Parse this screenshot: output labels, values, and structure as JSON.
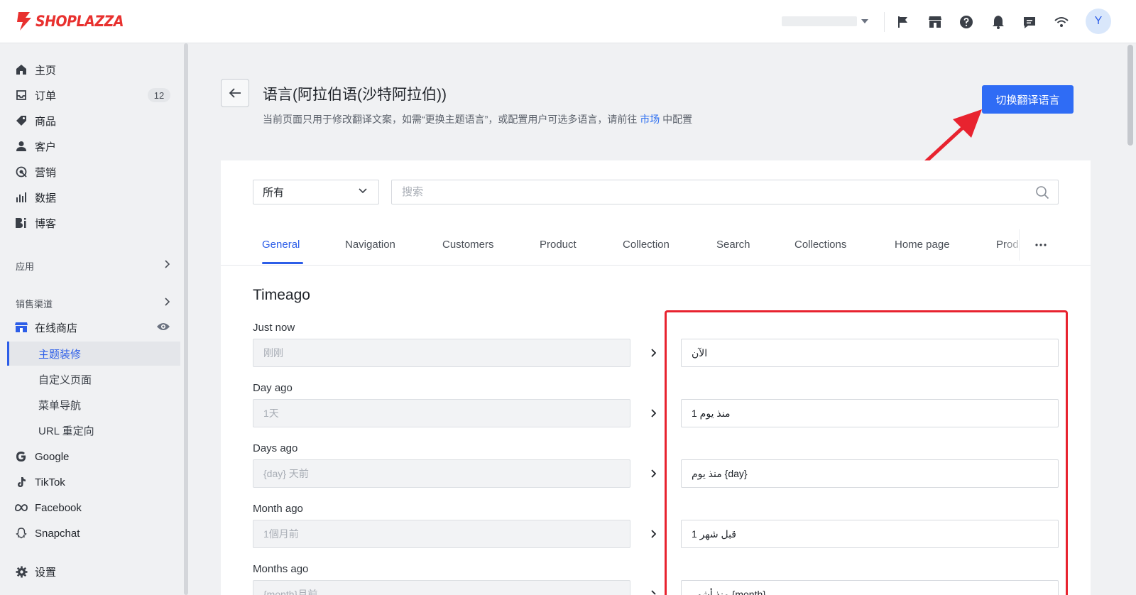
{
  "app": {
    "brand": "SHOPLAZZA",
    "avatar_initial": "Y",
    "accent": "#2f6cf5",
    "brand_color": "#e8312f",
    "highlight_color": "#e8232f"
  },
  "topbar": {
    "icons": [
      "flag-icon",
      "store-icon",
      "help-icon",
      "bell-icon",
      "chat-icon",
      "wifi-icon"
    ]
  },
  "sidebar": {
    "items": [
      {
        "label": "主页",
        "icon": "home-icon"
      },
      {
        "label": "订单",
        "icon": "inbox-icon",
        "badge": "12"
      },
      {
        "label": "商品",
        "icon": "tag-icon"
      },
      {
        "label": "客户",
        "icon": "user-icon"
      },
      {
        "label": "营销",
        "icon": "marketing-icon"
      },
      {
        "label": "数据",
        "icon": "bar-chart-icon"
      },
      {
        "label": "博客",
        "icon": "blog-icon"
      }
    ],
    "apps_label": "应用",
    "channels_label": "销售渠道",
    "online_store": "在线商店",
    "sub_items": [
      "主题装修",
      "自定义页面",
      "菜单导航",
      "URL 重定向"
    ],
    "channels": [
      {
        "label": "Google",
        "icon": "google-icon"
      },
      {
        "label": "TikTok",
        "icon": "tiktok-icon"
      },
      {
        "label": "Facebook",
        "icon": "meta-icon"
      },
      {
        "label": "Snapchat",
        "icon": "snapchat-icon"
      }
    ],
    "settings": "设置"
  },
  "header": {
    "title": "语言(阿拉伯语(沙特阿拉伯))",
    "desc_before": "当前页面只用于修改翻译文案，如需“更换主题语言”，或配置用户可选多语言，请前往",
    "desc_link": "市场",
    "desc_after": "中配置",
    "switch_button": "切换翻译语言"
  },
  "filter": {
    "selected": "所有",
    "search_placeholder": "搜索"
  },
  "tabs": [
    "General",
    "Navigation",
    "Customers",
    "Product",
    "Collection",
    "Search",
    "Collections",
    "Home page",
    "Produ"
  ],
  "section": {
    "title": "Timeago",
    "rows": [
      {
        "label": "Just now",
        "source": "刚刚",
        "target": "الآن"
      },
      {
        "label": "Day ago",
        "source": "1天",
        "target": "منذ يوم 1"
      },
      {
        "label": "Days ago",
        "source": "{day} 天前",
        "target": "منذ يوم {day}"
      },
      {
        "label": "Month ago",
        "source": "1個月前",
        "target": "قبل شهر 1"
      },
      {
        "label": "Months ago",
        "source": "{month}月前",
        "target": "منذ أشهر {month}"
      }
    ]
  }
}
